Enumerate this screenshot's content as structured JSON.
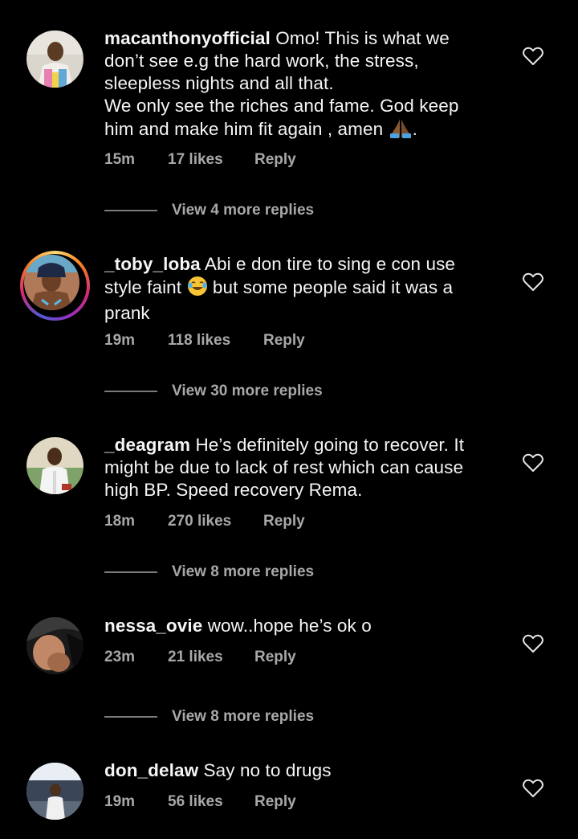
{
  "comments": [
    {
      "username": "macanthonyofficial",
      "text_lines": [
        " Omo! This is what we",
        "don’t see e.g the hard work, the stress,",
        "sleepless nights and all that.",
        "We only see the riches and fame. God keep",
        "him and make him fit again , amen "
      ],
      "trailing_text": ".",
      "emoji": "folded-hands",
      "time": "15m",
      "likes": "17 likes",
      "reply": "Reply",
      "view_more": "View 4 more replies"
    },
    {
      "username": "_toby_loba",
      "text_lines": [
        " Abi e don tire to sing e con use",
        "style faint ",
        "prank"
      ],
      "text_line2_after_emoji": " but some people said  it was a",
      "emoji": "tears-of-joy",
      "time": "19m",
      "likes": "118 likes",
      "reply": "Reply",
      "view_more": "View 30 more replies"
    },
    {
      "username": "_deagram",
      "text_lines": [
        " He’s definitely going to recover. It",
        "might be due to lack of rest which can cause",
        "high BP. Speed recovery Rema."
      ],
      "time": "18m",
      "likes": "270 likes",
      "reply": "Reply",
      "view_more": "View 8 more replies"
    },
    {
      "username": "nessa_ovie",
      "text_lines": [
        " wow..hope he’s ok o"
      ],
      "time": "23m",
      "likes": "21 likes",
      "reply": "Reply",
      "view_more": "View 8 more replies"
    },
    {
      "username": "don_delaw",
      "text_lines": [
        " Say no to drugs"
      ],
      "time": "19m",
      "likes": "56 likes",
      "reply": "Reply"
    }
  ],
  "colors": {
    "background": "#000000",
    "text": "#f5f5f5",
    "meta": "#a8a8a8"
  }
}
